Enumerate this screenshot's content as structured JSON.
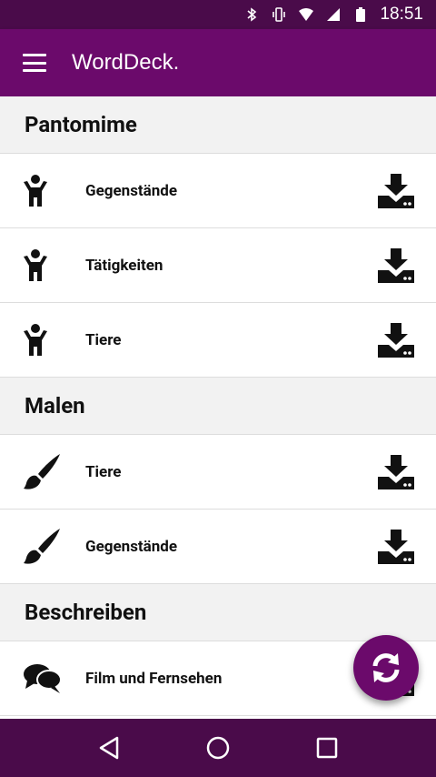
{
  "status_bar": {
    "time": "18:51"
  },
  "app_bar": {
    "title": "WordDeck."
  },
  "sections": [
    {
      "title": "Pantomime",
      "icon": "person-icon",
      "items": [
        {
          "label": "Gegenstände"
        },
        {
          "label": "Tätigkeiten"
        },
        {
          "label": "Tiere"
        }
      ]
    },
    {
      "title": "Malen",
      "icon": "paintbrush-icon",
      "items": [
        {
          "label": "Tiere"
        },
        {
          "label": "Gegenstände"
        }
      ]
    },
    {
      "title": "Beschreiben",
      "icon": "speech-bubbles-icon",
      "items": [
        {
          "label": "Film und Fernsehen"
        }
      ]
    }
  ],
  "colors": {
    "status_bar": "#4a0b4a",
    "app_bar": "#6b0a6b",
    "fab": "#6b0a6b"
  }
}
